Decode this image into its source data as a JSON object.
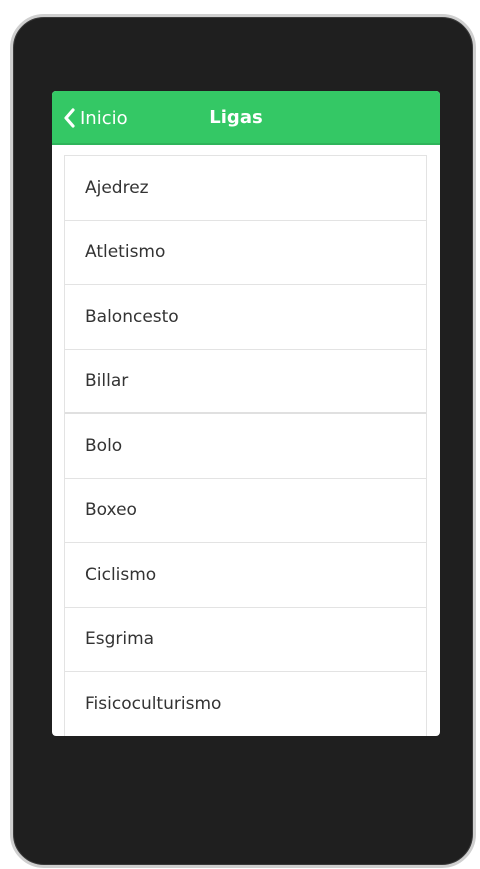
{
  "header": {
    "back_label": "Inicio",
    "title": "Ligas",
    "accent_color": "#34c865"
  },
  "list": {
    "items": [
      {
        "label": "Ajedrez"
      },
      {
        "label": "Atletismo"
      },
      {
        "label": "Baloncesto"
      },
      {
        "label": "Billar"
      },
      {
        "label": "Bolo"
      },
      {
        "label": "Boxeo"
      },
      {
        "label": "Ciclismo"
      },
      {
        "label": "Esgrima"
      },
      {
        "label": "Fisicoculturismo"
      }
    ]
  },
  "icons": {
    "back": "chevron-left-icon"
  }
}
